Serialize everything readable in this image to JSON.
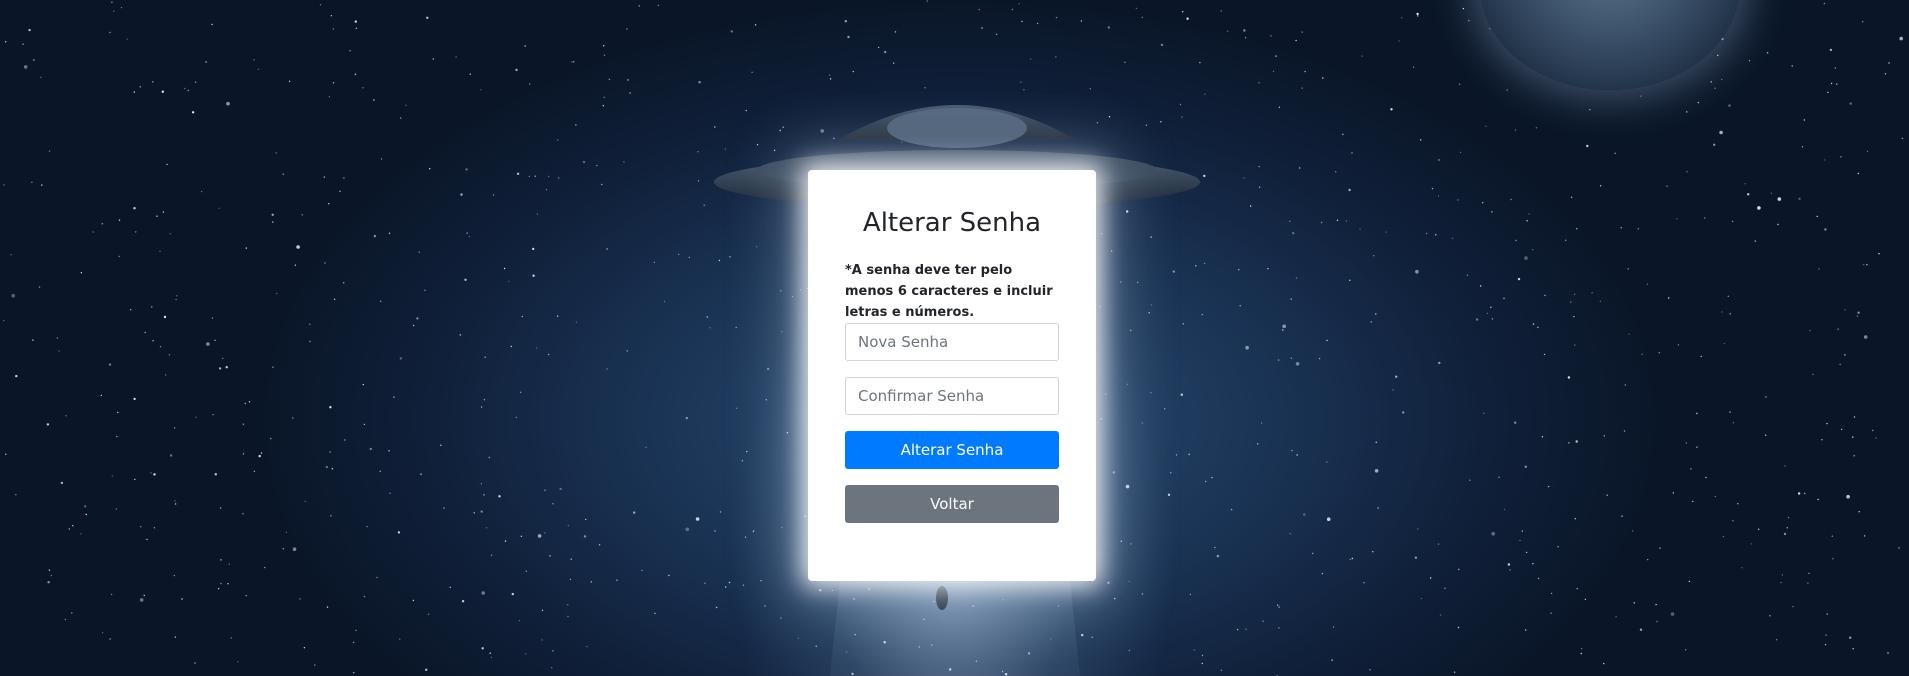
{
  "page": {
    "title": "Alterar Senha",
    "hint": "*A senha deve ter pelo menos 6 caracteres e incluir letras e números."
  },
  "form": {
    "new_password_placeholder": "Nova Senha",
    "confirm_password_placeholder": "Confirmar Senha",
    "submit_label": "Alterar Senha",
    "back_label": "Voltar"
  },
  "colors": {
    "primary_button": "#007bff",
    "secondary_button": "#6c757d",
    "card_background": "#ffffff",
    "sky_dark": "#0a1628"
  },
  "background": {
    "icon": "space-ufo-background"
  }
}
